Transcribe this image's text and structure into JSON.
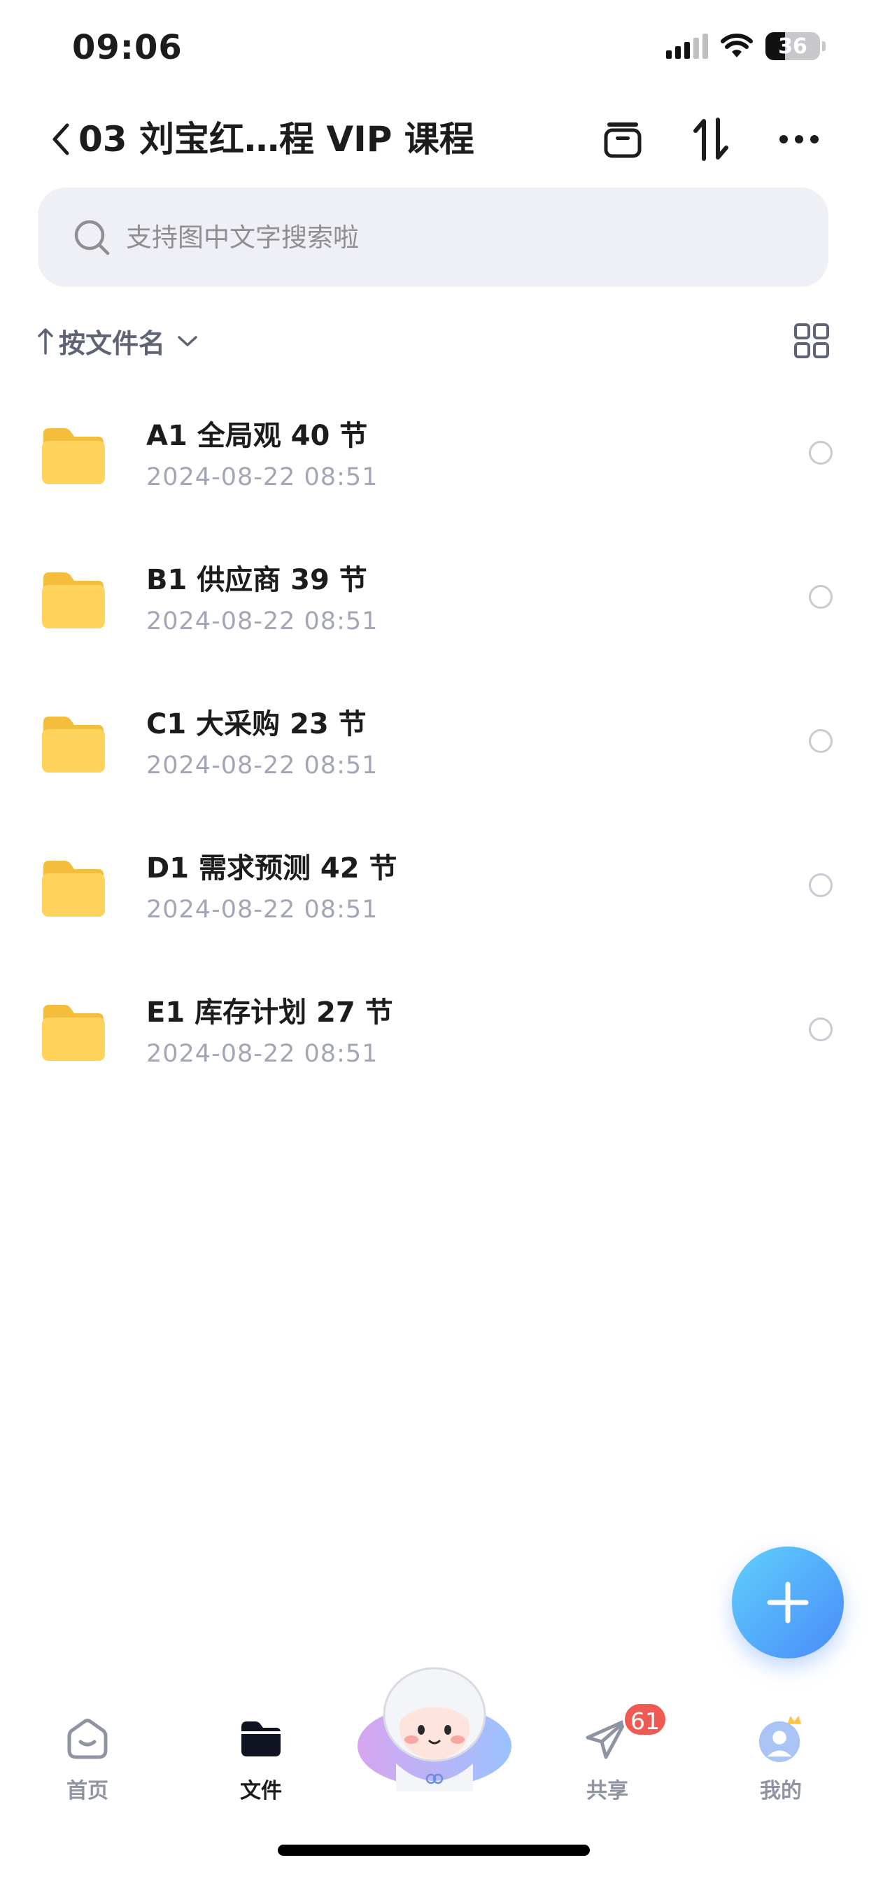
{
  "status_bar": {
    "time": "09:06",
    "battery_percent": "36"
  },
  "nav": {
    "title": "03 刘宝红…程 VIP 课程",
    "icons": [
      "back-chevron-icon",
      "archive-icon",
      "sort-swap-icon",
      "more-icon"
    ]
  },
  "search": {
    "placeholder": "支持图中文字搜索啦"
  },
  "sort": {
    "label": "按文件名",
    "direction": "ascending"
  },
  "files": [
    {
      "name": "A1 全局观 40 节",
      "date": "2024-08-22 08:51"
    },
    {
      "name": "B1 供应商 39 节",
      "date": "2024-08-22 08:51"
    },
    {
      "name": "C1 大采购 23 节",
      "date": "2024-08-22 08:51"
    },
    {
      "name": "D1 需求预测 42 节",
      "date": "2024-08-22 08:51"
    },
    {
      "name": "E1 库存计划 27 节",
      "date": "2024-08-22 08:51"
    }
  ],
  "tabs": [
    {
      "label": "首页",
      "icon": "home-face-icon",
      "active": false
    },
    {
      "label": "文件",
      "icon": "folder-icon",
      "active": true
    },
    {
      "label": "共享",
      "icon": "paper-plane-icon",
      "active": false,
      "badge": "61"
    },
    {
      "label": "我的",
      "icon": "avatar-crown-icon",
      "active": false
    }
  ],
  "colors": {
    "accent_blue": "#4a8bfb",
    "folder_yellow": "#ffd35c",
    "badge_red": "#ef5a55",
    "muted_text": "#a3a6b4"
  }
}
